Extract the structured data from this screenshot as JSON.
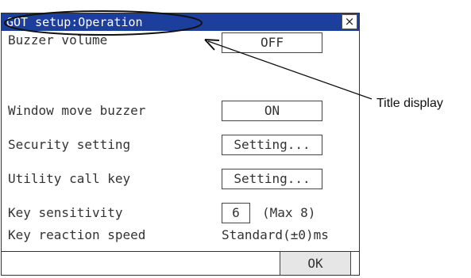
{
  "window": {
    "title": "GOT setup:Operation",
    "close_label": "×"
  },
  "settings": {
    "buzzer_volume": {
      "label": "Buzzer volume",
      "value": "OFF"
    },
    "window_move_buzzer": {
      "label": "Window move buzzer",
      "value": "ON"
    },
    "security_setting": {
      "label": "Security setting",
      "value": "Setting..."
    },
    "utility_call_key": {
      "label": "Utility call key",
      "value": "Setting..."
    },
    "key_sensitivity": {
      "label": "Key sensitivity",
      "value": "6",
      "max_note": "(Max 8)"
    },
    "key_reaction_speed": {
      "label": "Key reaction speed",
      "value": "Standard(±0)ms"
    }
  },
  "footer": {
    "ok_label": "OK"
  },
  "annotation": {
    "callout_text": "Title display"
  }
}
